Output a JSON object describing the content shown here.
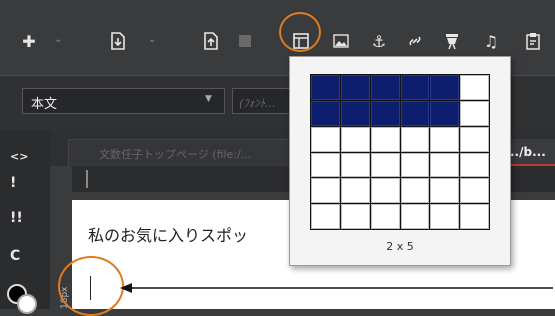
{
  "toolbar": {
    "icons": [
      "plus-icon",
      "new-document-icon",
      "save-document-icon",
      "stop-icon",
      "table-icon",
      "image-icon",
      "anchor-icon",
      "link-icon",
      "video-icon",
      "music-icon",
      "clipboard-icon"
    ]
  },
  "format": {
    "style_value": "本文",
    "font_placeholder": "(ﾌｫﾝﾄ..."
  },
  "left_panel": {
    "items": [
      "<>",
      "!",
      "!!",
      "C"
    ]
  },
  "tabs": {
    "faded_label": "文数任子トップページ (file:/...",
    "active_label": "../b..."
  },
  "editor": {
    "text": "私のお気に入りスポッ",
    "ruler_label": "18px"
  },
  "table_popup": {
    "rows": 6,
    "cols": 6,
    "selected_rows": 2,
    "selected_cols": 5,
    "label": "2 x 5"
  },
  "colors": {
    "selection": "#0d1e6e",
    "annotation": "#e07b1f",
    "tab_underline": "#c0392b"
  }
}
